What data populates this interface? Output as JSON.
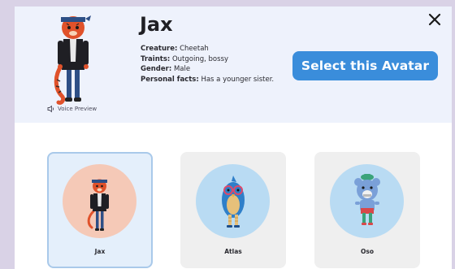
{
  "avatar": {
    "name": "Jax",
    "facts": [
      {
        "label": "Creature:",
        "value": "Cheetah"
      },
      {
        "label": "Traints:",
        "value": "Outgoing, bossy"
      },
      {
        "label": "Gender:",
        "value": "Male"
      },
      {
        "label": "Personal facts:",
        "value": "Has a younger sister."
      }
    ],
    "voice_preview_label": "Voice Preview"
  },
  "actions": {
    "select_label": "Select this Avatar",
    "close_label": "✕"
  },
  "cards": [
    {
      "label": "Jax",
      "selected": true,
      "bg": "#f5c9b7"
    },
    {
      "label": "Atlas",
      "selected": false,
      "bg": "#b9dbf3"
    },
    {
      "label": "Oso",
      "selected": false,
      "bg": "#b9dbf3"
    }
  ],
  "colors": {
    "accent": "#3a8ddb",
    "header_bg": "#eef2fc",
    "page_bg": "#d9d2e6"
  }
}
